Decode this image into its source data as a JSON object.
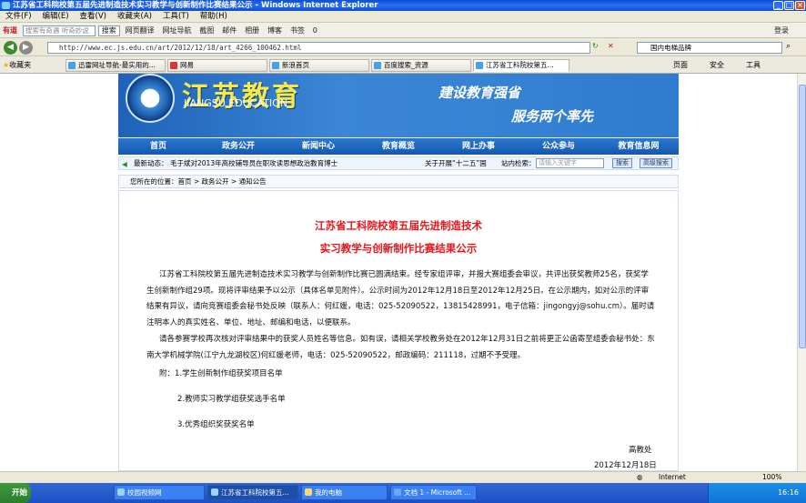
{
  "window": {
    "title": "江苏省工科院校第五届先进制造技术实习教学与创新制作比赛结果公示 - Windows Internet Explorer"
  },
  "menu": [
    "文件(F)",
    "编辑(E)",
    "查看(V)",
    "收藏夹(A)",
    "工具(T)",
    "帮助(H)"
  ],
  "toolbar": {
    "brand": "有道",
    "search_placeholder": "搜索有奇遇 听奇妙说",
    "search_button": "搜索",
    "items": [
      "网页翻译",
      "网址导航",
      "截图",
      "邮件",
      "相册",
      "博客",
      "书签",
      "0"
    ],
    "login": "登录"
  },
  "address": {
    "url": "http://www.ec.js.edu.cn/art/2012/12/18/art_4266_100462.html",
    "search_value": "国内电梯品牌"
  },
  "favorites": {
    "label": "收藏夹",
    "tabs": [
      "迅雷网址导航-最实用的...",
      "网易",
      "新浪首页",
      "百度搜索_资源",
      "江苏省工科院校第五..."
    ],
    "tools": [
      "页面",
      "安全",
      "工具"
    ]
  },
  "site": {
    "name": "江苏教育",
    "name_en": "JIANGSU EDUCATION",
    "slogan1": "建设教育强省",
    "slogan2": "服务两个率先",
    "nav": [
      "首页",
      "政务公开",
      "新闻中心",
      "教育概览",
      "网上办事",
      "公众参与",
      "教育信息网"
    ],
    "news_label": "最新动态：",
    "news_item": "毛于斌对2013年高校辅导员在职攻读思想政治教育博士",
    "news_item2": "关于开展“十二五”国",
    "site_search_label": "站内检索：",
    "site_search_placeholder": "请输入关键字",
    "btn_search": "搜索",
    "btn_advanced": "高级搜索",
    "breadcrumb": "您所在的位置：首页 > 政务公开 > 通知公告"
  },
  "article": {
    "title_line1": "江苏省工科院校第五届先进制造技术",
    "title_line2": "实习教学与创新制作比赛结果公示",
    "para1": "江苏省工科院校第五届先进制造技术实习教学与创新制作比赛已圆满结束。经专家组评审，并报大赛组委会审议，共评出获奖教师25名，获奖学生创新制作组29项。现将评审结果予以公示（具体名单见附件）。公示时间为2012年12月18日至2012年12月25日。在公示期内，如对公示的评审结果有异议，请向竞赛组委会秘书处反映（联系人：何红媛，电话：025-52090522，13815428991，电子信箱：jingongyj@sohu.cm）。届时请注明本人的真实姓名、单位、地址、邮编和电话，以便联系。",
    "para2": "请各参赛学校再次核对评审结果中的获奖人员姓名等信息。如有误，请相关学校教务处在2012年12月31日之前将更正公函寄至组委会秘书处：东南大学机械学院(江宁九龙湖校区)何红媛老师，电话：025-52090522，邮政编码：211118，过期不予受理。",
    "attach1": "附：1.学生创新制作组获奖项目名单",
    "attach2": "2.教师实习教学组获奖选手名单",
    "attach3": "3.优秀组织奖获奖名单",
    "signer": "高教处",
    "date": "2012年12月18日"
  },
  "status": {
    "zone": "Internet",
    "zoom": "100%"
  },
  "taskbar": {
    "start": "开始",
    "items": [
      "校园视频网",
      "江苏省工科院校第五...",
      "我的电脑",
      "文档 1 - Microsoft ..."
    ],
    "clock": "16:16"
  }
}
